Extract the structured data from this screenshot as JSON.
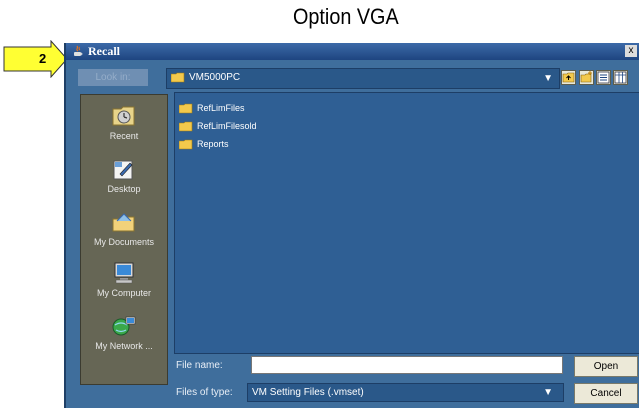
{
  "caption": "Option VGA",
  "callout_number": "2",
  "dialog": {
    "title": "Recall",
    "close_glyph": "x",
    "look_in_label": "Look in:",
    "look_in_value": "VM5000PC",
    "toolbar_icons": [
      "up-one-level-icon",
      "create-new-folder-icon",
      "list-view-icon",
      "details-view-icon"
    ],
    "sidebar": [
      {
        "label": "Recent",
        "icon": "recent-icon"
      },
      {
        "label": "Desktop",
        "icon": "desktop-icon"
      },
      {
        "label": "My Documents",
        "icon": "my-documents-icon"
      },
      {
        "label": "My Computer",
        "icon": "my-computer-icon"
      },
      {
        "label": "My Network ...",
        "icon": "my-network-icon"
      }
    ],
    "files": [
      {
        "name": "RefLimFiles",
        "icon": "folder-icon"
      },
      {
        "name": "RefLimFilesold",
        "icon": "folder-icon"
      },
      {
        "name": "Reports",
        "icon": "folder-icon"
      }
    ],
    "file_name_label": "File name:",
    "file_name_value": "",
    "files_of_type_label": "Files of type:",
    "files_of_type_value": "VM Setting Files (.vmset)",
    "open_label": "Open",
    "cancel_label": "Cancel"
  },
  "colors": {
    "dialog_bg": "#3f6e9c",
    "titlebar": "#1e4580",
    "callout": "#ffff33",
    "sidebar_bg": "#666655",
    "file_pane_bg": "#2f5f94",
    "folder": "#f2c94c"
  }
}
